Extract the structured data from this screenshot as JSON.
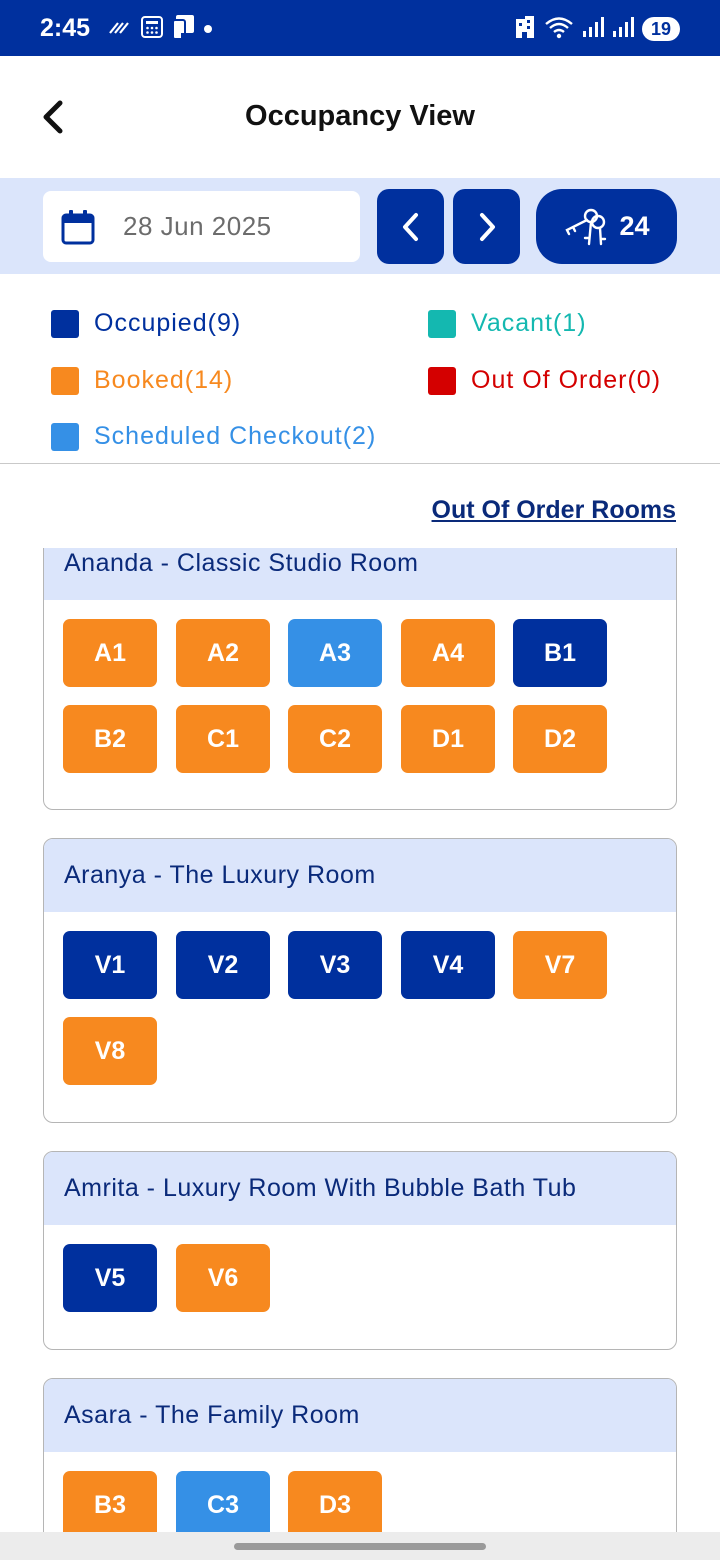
{
  "status_bar": {
    "time": "2:45",
    "battery": "19"
  },
  "header": {
    "title": "Occupancy View"
  },
  "toolbar": {
    "date": "28 Jun 2025",
    "keys_count": "24"
  },
  "legend": [
    {
      "label": "Occupied(9)",
      "color": "#00309e"
    },
    {
      "label": "Vacant(1)",
      "color": "#14b8b0"
    },
    {
      "label": "Booked(14)",
      "color": "#f7891f"
    },
    {
      "label": "Out Of Order(0)",
      "color": "#d40000"
    },
    {
      "label": "Scheduled Checkout(2)",
      "color": "#3590e6"
    }
  ],
  "status_colors": {
    "occupied": "#00309e",
    "vacant": "#14b8b0",
    "booked": "#f7891f",
    "out_of_order": "#d40000",
    "scheduled": "#3590e6"
  },
  "out_of_order_link": "Out Of Order Rooms",
  "room_groups": [
    {
      "name": "Ananda - Classic Studio Room",
      "rooms": [
        {
          "label": "A1",
          "status": "booked"
        },
        {
          "label": "A2",
          "status": "booked"
        },
        {
          "label": "A3",
          "status": "scheduled"
        },
        {
          "label": "A4",
          "status": "booked"
        },
        {
          "label": "B1",
          "status": "occupied"
        },
        {
          "label": "B2",
          "status": "booked"
        },
        {
          "label": "C1",
          "status": "booked"
        },
        {
          "label": "C2",
          "status": "booked"
        },
        {
          "label": "D1",
          "status": "booked"
        },
        {
          "label": "D2",
          "status": "booked"
        }
      ]
    },
    {
      "name": "Aranya - The Luxury Room",
      "rooms": [
        {
          "label": "V1",
          "status": "occupied"
        },
        {
          "label": "V2",
          "status": "occupied"
        },
        {
          "label": "V3",
          "status": "occupied"
        },
        {
          "label": "V4",
          "status": "occupied"
        },
        {
          "label": "V7",
          "status": "booked"
        },
        {
          "label": "V8",
          "status": "booked"
        }
      ]
    },
    {
      "name": "Amrita - Luxury Room With Bubble Bath Tub",
      "rooms": [
        {
          "label": "V5",
          "status": "occupied"
        },
        {
          "label": "V6",
          "status": "booked"
        }
      ]
    },
    {
      "name": "Asara - The Family Room",
      "rooms": [
        {
          "label": "B3",
          "status": "booked"
        },
        {
          "label": "C3",
          "status": "scheduled"
        },
        {
          "label": "D3",
          "status": "booked"
        }
      ]
    }
  ]
}
